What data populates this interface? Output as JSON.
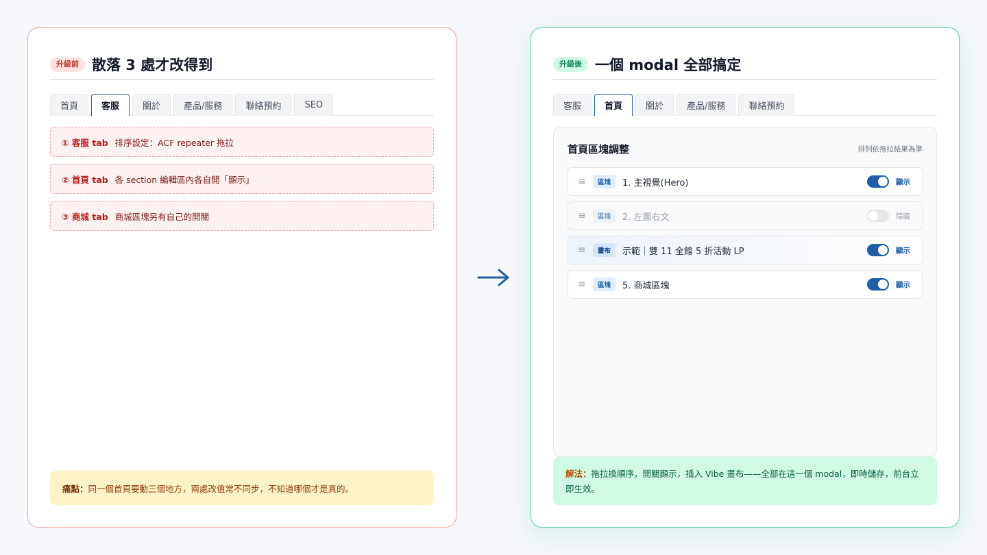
{
  "left": {
    "badge": "升級前",
    "title": "散落 3 處才改得到",
    "tabs": [
      "首頁",
      "客服",
      "關於",
      "產品/服務",
      "聯絡預約",
      "SEO"
    ],
    "issues": [
      {
        "num": "① 客服 tab",
        "text": "排序設定：ACF repeater 拖拉"
      },
      {
        "num": "② 首頁 tab",
        "text": "各 section 編輯區內各自開「顯示」"
      },
      {
        "num": "③ 商城 tab",
        "text": "商城區塊另有自己的開關"
      }
    ],
    "pain_label": "痛點：",
    "pain_text": "同一個首頁要動三個地方，兩處改值常不同步，不知道哪個才是真的。"
  },
  "arrow_icon": "right-arrow",
  "right": {
    "badge": "升級後",
    "title": "一個 modal 全部搞定",
    "tabs": [
      "客服",
      "首頁",
      "關於",
      "產品/服務",
      "聯絡預約"
    ],
    "modal": {
      "title": "首頁區塊調整",
      "hint": "排列依拖拉結果為準",
      "rows": [
        {
          "tag": "區塊",
          "label": "1. 主視覺(Hero)",
          "on": true,
          "state": "顯示"
        },
        {
          "tag": "區塊",
          "label": "2. 左圖右文",
          "on": false,
          "state": "隱藏"
        },
        {
          "tag": "畫布",
          "label": "示範｜雙 11 全館 5 折活動 LP",
          "on": true,
          "state": "顯示"
        },
        {
          "tag": "區塊",
          "label": "5. 商城區塊",
          "on": true,
          "state": "顯示"
        }
      ]
    },
    "solution_label": "解法：",
    "solution_text": "拖拉換順序，開關顯示，插入 Vibe 畫布——全部在這一個 modal，即時儲存，前台立即生效。"
  },
  "colors": {
    "before_border": "#f2a7a0",
    "after_border": "#5fd3a6",
    "accent": "#1e5fa8"
  }
}
